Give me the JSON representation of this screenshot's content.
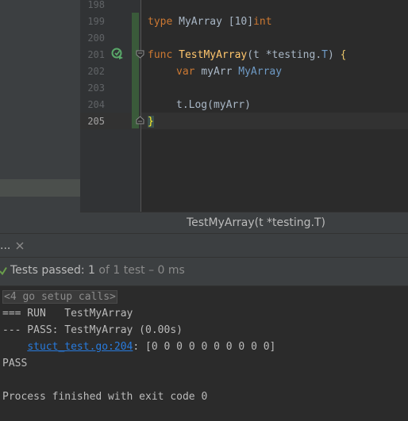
{
  "editor": {
    "lines": [
      {
        "num": "198",
        "text": ""
      },
      {
        "num": "199",
        "kw": "type",
        "name": "MyArray",
        "bracket": "[10]",
        "type": "int"
      },
      {
        "num": "200",
        "text": ""
      },
      {
        "num": "201",
        "kw": "func",
        "fn": "TestMyArray",
        "param_open": "(t *testing.",
        "param_type": "T",
        "param_close": ")",
        "brace": "{"
      },
      {
        "num": "202",
        "kw": "var",
        "name": "myArr",
        "type": "MyArray"
      },
      {
        "num": "203",
        "text": ""
      },
      {
        "num": "204",
        "text": "t.Log(myArr)"
      },
      {
        "num": "205",
        "brace": "}"
      }
    ],
    "current_line": "205"
  },
  "breadcrumb": {
    "text": "TestMyArray(t *testing.T)"
  },
  "tool_window": {
    "tab_label": "...",
    "status": {
      "prefix": "Tests passed: ",
      "passed": "1",
      "of": " of ",
      "total": "1 test",
      "duration": " – 0 ms"
    },
    "console": {
      "collapsed": "<4 go setup calls>",
      "run_line": "=== RUN   TestMyArray",
      "pass_line": "--- PASS: TestMyArray (0.00s)",
      "log_indent": "    ",
      "log_link": "stuct_test.go:204",
      "log_rest": ": [0 0 0 0 0 0 0 0 0 0]",
      "pass": "PASS",
      "exit": "Process finished with exit code 0"
    }
  },
  "colors": {
    "background": "#2b2b2b",
    "keyword": "#cc7832",
    "function": "#ffc66d",
    "type": "#6f9bc6",
    "link": "#287bde",
    "success": "#6a9f4b"
  }
}
